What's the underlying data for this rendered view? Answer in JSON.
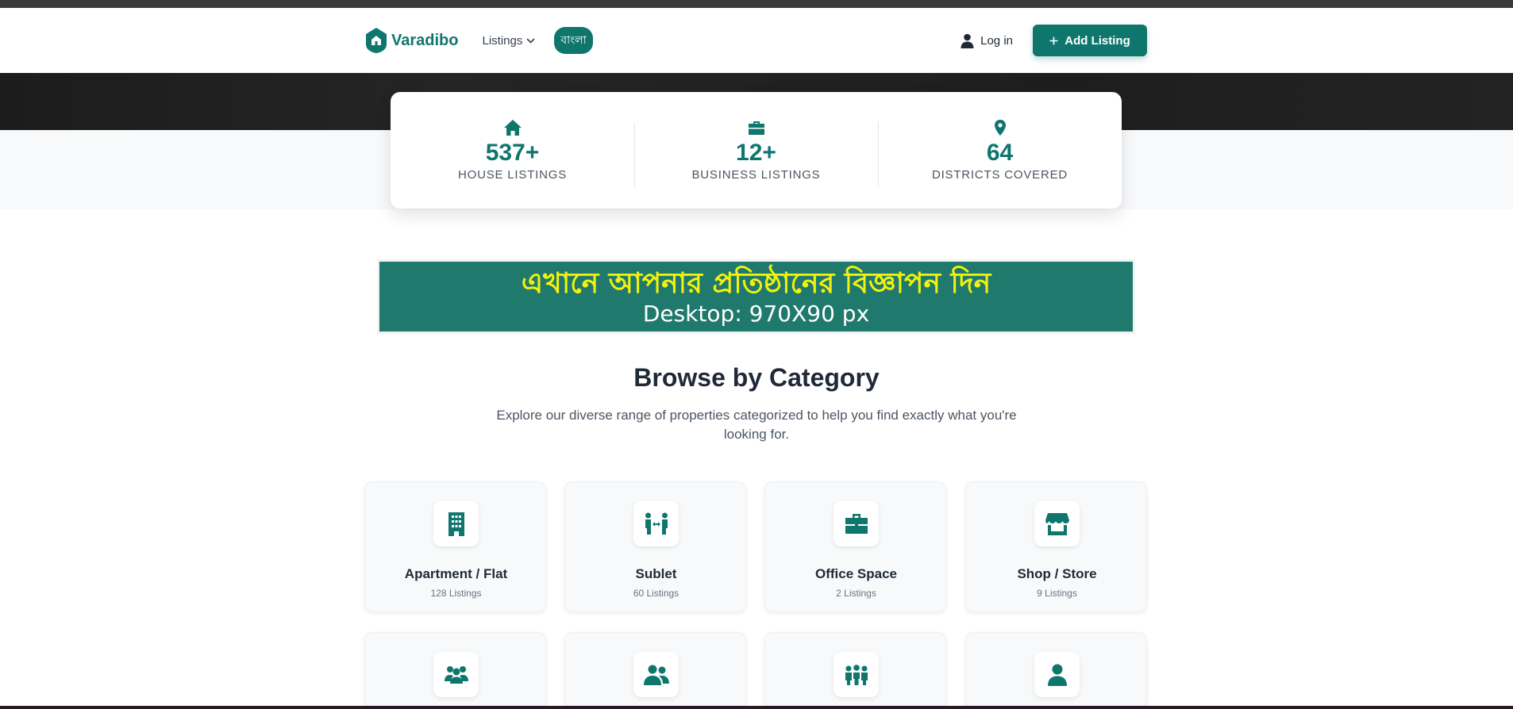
{
  "brand": {
    "name": "Varadibo",
    "color": "#0f766e"
  },
  "nav": {
    "listings_label": "Listings",
    "lang_label": "বাংলা",
    "login_label": "Log in",
    "add_listing_label": "Add Listing"
  },
  "stats": [
    {
      "icon": "home-icon",
      "value": "537+",
      "label": "HOUSE LISTINGS"
    },
    {
      "icon": "briefcase-icon",
      "value": "12+",
      "label": "BUSINESS LISTINGS"
    },
    {
      "icon": "map-pin-icon",
      "value": "64",
      "label": "DISTRICTS COVERED"
    }
  ],
  "ad": {
    "line1": "এখানে আপনার প্রতিষ্ঠানের বিজ্ঞাপন দিন",
    "line2": "Desktop: 970X90 px"
  },
  "categories_section": {
    "title": "Browse by Category",
    "subtitle": "Explore our diverse range of properties categorized to help you find exactly what you're looking for."
  },
  "categories": [
    {
      "icon": "building-icon",
      "name": "Apartment / Flat",
      "count": "128 Listings"
    },
    {
      "icon": "people-arrows-icon",
      "name": "Sublet",
      "count": "60 Listings"
    },
    {
      "icon": "briefcase-icon",
      "name": "Office Space",
      "count": "2 Listings"
    },
    {
      "icon": "store-icon",
      "name": "Shop / Store",
      "count": "9 Listings"
    }
  ],
  "categories_row2_icons": [
    "users-icon",
    "user-group-icon",
    "people-group-icon",
    "user-icon"
  ]
}
